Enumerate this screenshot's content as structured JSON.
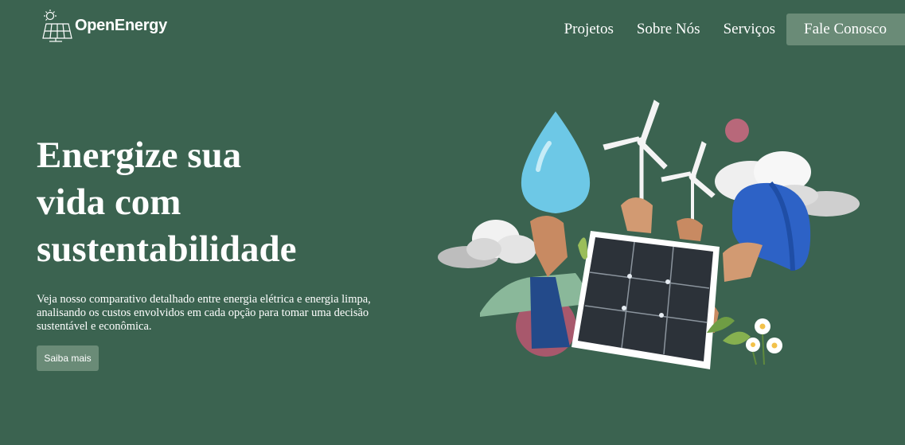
{
  "header": {
    "logo_text": "OpenEnergy",
    "nav": [
      {
        "label": "Projetos",
        "icon": null
      },
      {
        "label": "Sobre Nós"
      },
      {
        "label": "Serviços"
      }
    ],
    "cta_label": "Fale Conosco"
  },
  "hero": {
    "title_lines": [
      "Energize sua",
      "vida com",
      "sustentabilidade"
    ],
    "description_lines": [
      "Veja nosso comparativo detalhado entre energia elétrica e energia limpa,",
      "analisando os custos envolvidos em cada opção para tomar uma decisão",
      "sustentável e econômica."
    ],
    "button_label": "Saiba mais"
  },
  "illustration": {
    "name": "renewable-energy-collage",
    "elements": [
      "water-drop",
      "wind-turbine",
      "wind-turbine",
      "solar-panel",
      "hard-hat",
      "cloud",
      "cloud",
      "flowers",
      "hands"
    ]
  },
  "colors": {
    "background": "#3b6350",
    "button": "#6a8b77",
    "text": "#ffffff"
  }
}
